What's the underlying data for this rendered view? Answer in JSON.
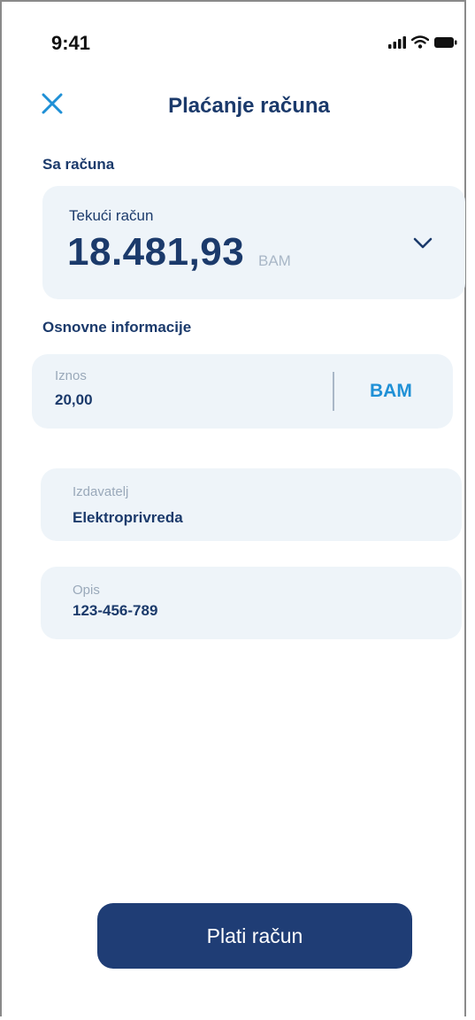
{
  "status_bar": {
    "time": "9:41"
  },
  "header": {
    "title": "Plaćanje računa",
    "close_icon": "close-icon"
  },
  "from_account": {
    "section_label": "Sa računa",
    "account_name": "Tekući račun",
    "balance": "18.481,93",
    "currency": "BAM"
  },
  "basic_info": {
    "section_label": "Osnovne informacije",
    "amount": {
      "label": "Iznos",
      "value": "20,00",
      "currency": "BAM"
    },
    "issuer": {
      "label": "Izdavatelj",
      "value": "Elektroprivreda"
    },
    "description": {
      "label": "Opis",
      "value": "123-456-789"
    }
  },
  "actions": {
    "pay_label": "Plati račun"
  },
  "colors": {
    "primary_navy": "#1b3a6b",
    "button_navy": "#1f3d75",
    "accent_blue": "#1f90d6",
    "card_background": "#eef4f9",
    "muted_label": "#9aa9ba"
  }
}
